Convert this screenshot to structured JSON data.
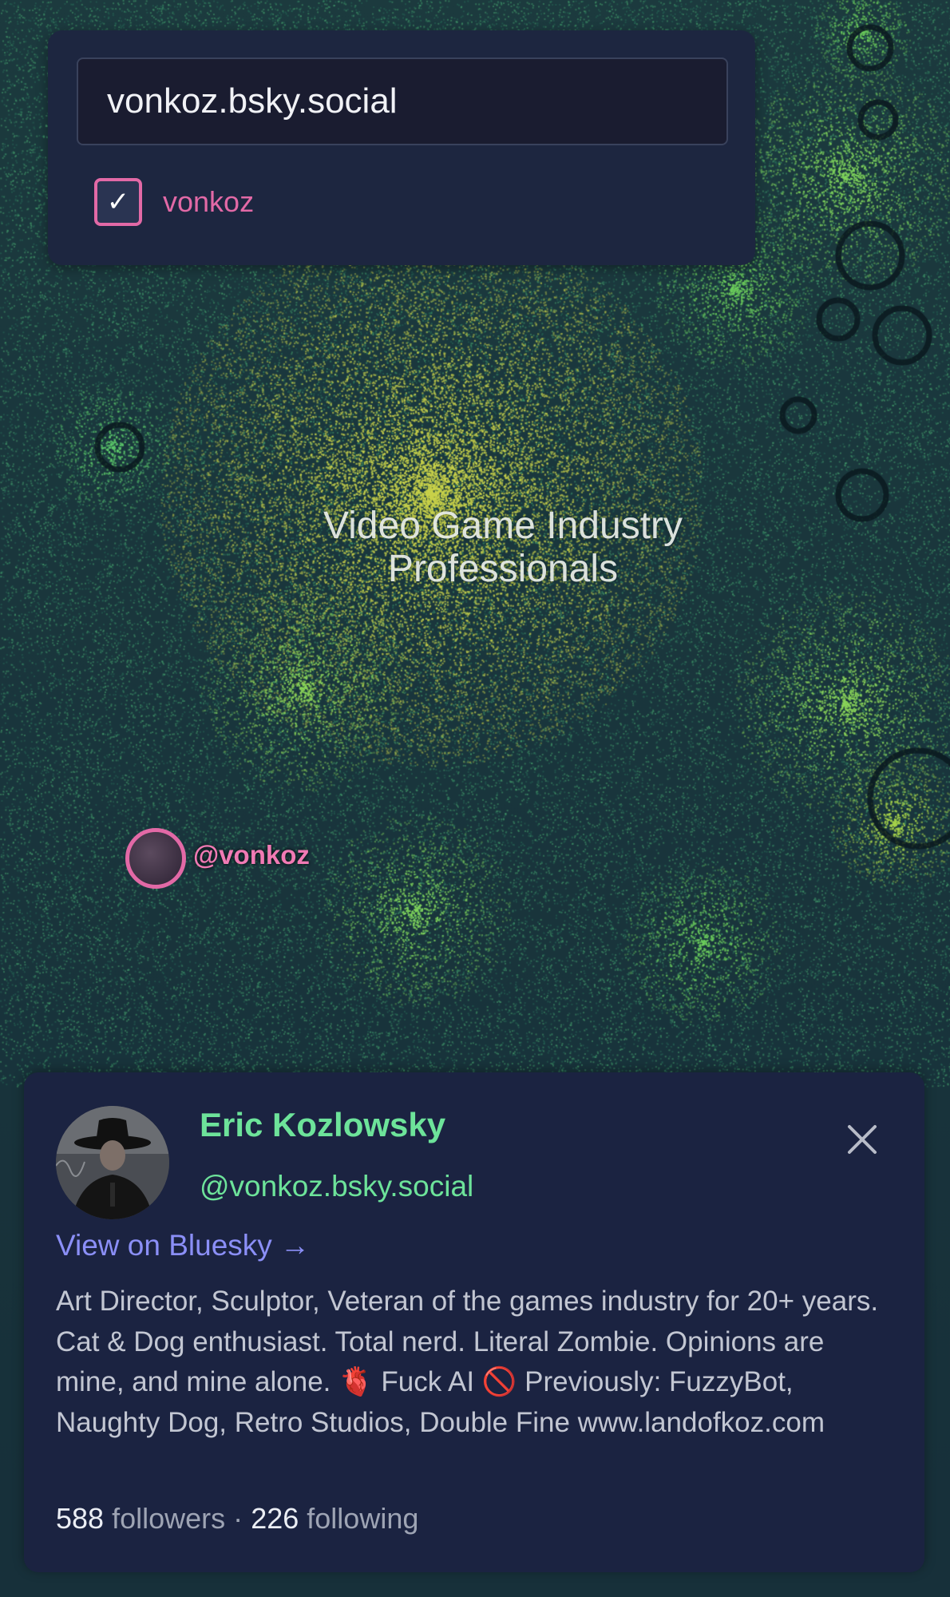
{
  "search": {
    "value": "vonkoz.bsky.social",
    "result_label": "vonkoz",
    "checked": true
  },
  "map": {
    "cluster_label_line1": "Video Game Industry",
    "cluster_label_line2": "Professionals",
    "user_marker_label": "@vonkoz"
  },
  "profile": {
    "display_name": "Eric Kozlowsky",
    "handle": "@vonkoz.bsky.social",
    "view_link": "View on Bluesky →",
    "bio": "Art Director, Sculptor, Veteran of the games industry for 20+ years. Cat & Dog enthusiast. Total nerd. Literal Zombie. Opinions are mine, and mine alone. 🫀 Fuck AI 🚫 Previously: FuzzyBot, Naughty Dog, Retro Studios, Double Fine www.landofkoz.com",
    "followers_count": "588",
    "followers_label": "followers",
    "separator": "·",
    "following_count": "226",
    "following_label": "following"
  },
  "colors": {
    "accent_pink": "#e269a6",
    "accent_green": "#6de39a",
    "link": "#8b8ff7",
    "panel": "#1b2341"
  }
}
